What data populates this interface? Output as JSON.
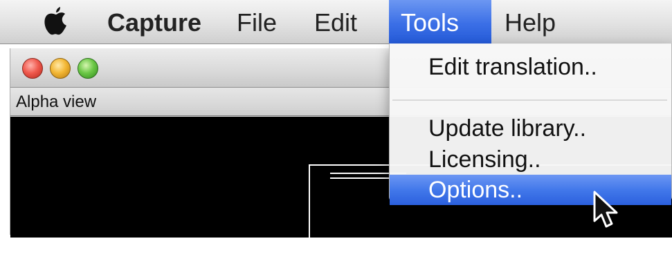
{
  "menubar": {
    "apple_icon": "apple-logo-icon",
    "app_name": "Capture",
    "items": [
      {
        "label": "File"
      },
      {
        "label": "Edit"
      },
      {
        "label": "Tools"
      },
      {
        "label": "Help"
      }
    ],
    "active_color": "#3b6fe6"
  },
  "window": {
    "buttons": [
      "close-button",
      "minimize-button",
      "zoom-button"
    ],
    "view_title": "Alpha view"
  },
  "tools_menu": {
    "items": [
      {
        "label": "Edit translation.."
      },
      {
        "label": "Update library.."
      },
      {
        "label": "Licensing.."
      },
      {
        "label": "Options.."
      }
    ],
    "highlighted": "Options.."
  },
  "cursor_icon": "arrow-pointer-icon"
}
